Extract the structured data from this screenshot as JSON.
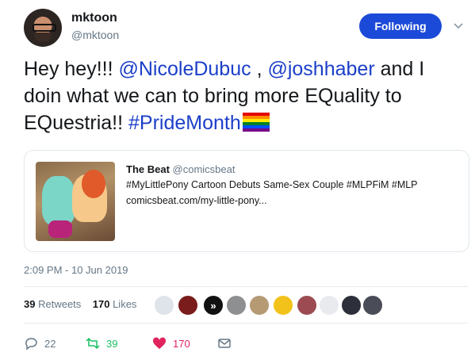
{
  "user": {
    "name": "mktoon",
    "handle": "@mktoon",
    "follow_label": "Following"
  },
  "tweet": {
    "prefix": "Hey hey!!! ",
    "mention1": "@NicoleDubuc",
    "sep": " , ",
    "mention2": "@joshhaber",
    "middle": " and I doin what we can to bring more EQuality to EQuestria!! ",
    "hashtag": "#PrideMonth"
  },
  "card": {
    "source_name": "The Beat",
    "source_handle": "@comicsbeat",
    "title": "#MyLittlePony Cartoon Debuts Same-Sex Couple #MLPFiM #MLP",
    "url": "comicsbeat.com/my-little-pony..."
  },
  "timestamp": "2:09 PM - 10 Jun 2019",
  "stats": {
    "retweets_count": "39",
    "retweets_label": "Retweets",
    "likes_count": "170",
    "likes_label": "Likes"
  },
  "actions": {
    "reply_count": "22",
    "retweet_count": "39",
    "like_count": "170"
  },
  "colors": {
    "accent": "#1c4ad8",
    "mention": "#1c3fc9",
    "retweet": "#17bf63",
    "like": "#e0245e",
    "muted": "#657786"
  },
  "liker_avatars": [
    "liker-avatar-1",
    "liker-avatar-2",
    "liker-avatar-3",
    "liker-avatar-4",
    "liker-avatar-5",
    "liker-avatar-6",
    "liker-avatar-7",
    "liker-avatar-8",
    "liker-avatar-9",
    "liker-avatar-10"
  ]
}
